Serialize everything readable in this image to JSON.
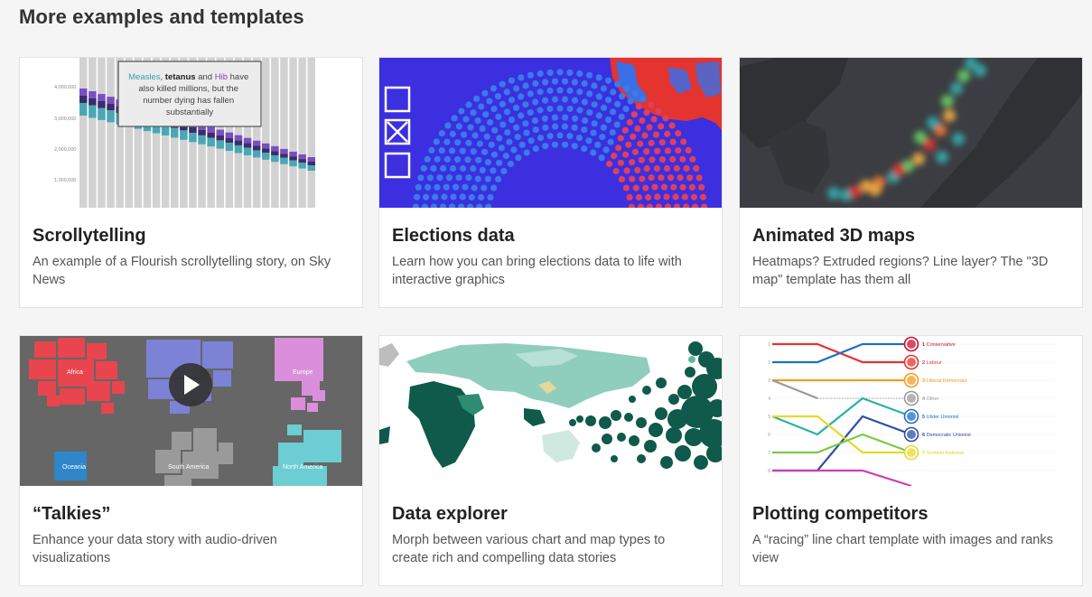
{
  "section": {
    "title": "More examples and templates"
  },
  "cards": [
    {
      "title": "Scrollytelling",
      "description": "An example of a Flourish scrollytelling story, on Sky News"
    },
    {
      "title": "Elections data",
      "description": "Learn how you can bring elections data to life with interactive graphics"
    },
    {
      "title": "Animated 3D maps",
      "description": "Heatmaps? Extruded regions? Line layer? The \"3D map\" template has them all"
    },
    {
      "title": "“Talkies”",
      "description": "Enhance your data story with audio-driven visualizations"
    },
    {
      "title": "Data explorer",
      "description": "Morph between various chart and map types to create rich and compelling data stories"
    },
    {
      "title": "Plotting competitors",
      "description": "A “racing” line chart template with images and ranks view"
    }
  ],
  "thumb_scrolly": {
    "axis_labels": [
      "4,000,000",
      "3,000,000",
      "2,000,000",
      "1,000,000"
    ],
    "tooltip": {
      "w1": "Measles",
      "w2": "tetanus",
      "w3": "and",
      "w4": "Hib",
      "w5": "have",
      "line2": "also killed millions, but the",
      "line3": "number dying has fallen",
      "line4": "substantially"
    }
  },
  "thumb_talkies": {
    "labels": {
      "africa": "Africa",
      "europe": "Europe",
      "south_america": "South America",
      "oceania": "Oceania",
      "north_america": "North America"
    }
  },
  "thumb_racing": {
    "labels": [
      "Conservative",
      "Labour",
      "Liberal Democrats",
      "Other",
      "Ulster Unionist",
      "Democratic Unionist",
      "Scottish National"
    ],
    "ranks": [
      "1",
      "2",
      "3",
      "4",
      "5",
      "6",
      "7"
    ]
  },
  "colors": {
    "measles": "#3aa0b0",
    "tetanus": "#6a4caa",
    "hib": "#8a3fb0",
    "election_blue": "#3b2fe0",
    "election_red": "#e3342f",
    "talkies_bg": "#666666",
    "explorer_green": "#0f5a4a"
  }
}
